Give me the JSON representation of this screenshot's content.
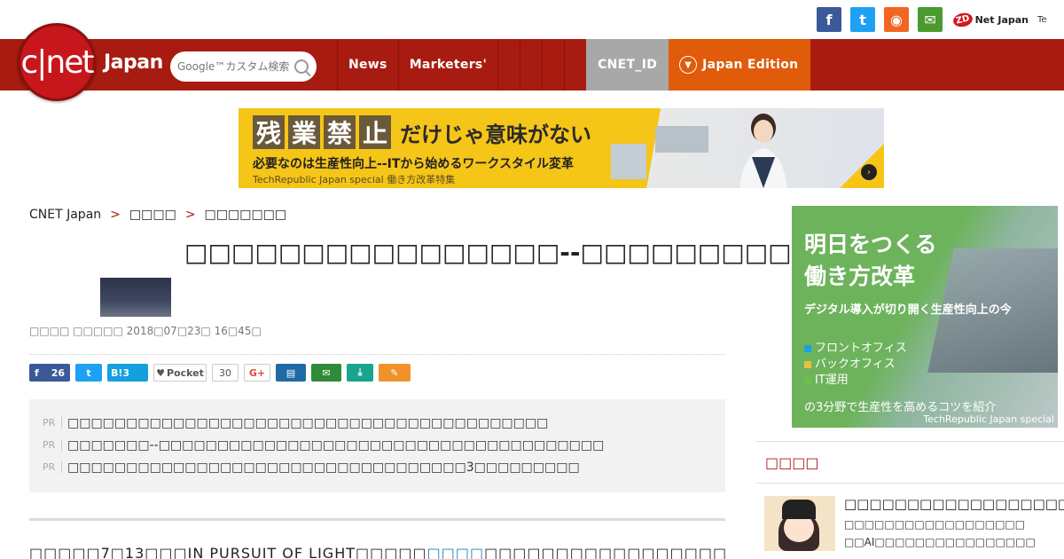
{
  "social": {
    "facebook_glyph": "f",
    "twitter_glyph": "t",
    "rss_glyph": "◉",
    "mail_glyph": "✉",
    "zdnet_badge": "ZD",
    "zdnet_label": "Net Japan",
    "techrepublic_label": "Te"
  },
  "nav": {
    "logo_text": "c|net",
    "logo_japan": "Japan",
    "search_placeholder": "Google™カスタム検索",
    "items": [
      "News",
      "Marketers'"
    ],
    "cnet_id": "CNET_ID",
    "edition": "Japan Edition"
  },
  "banner": {
    "kanji": [
      "残",
      "業",
      "禁",
      "止"
    ],
    "headline_rest": "だけじゃ意味がない",
    "subline": "必要なのは生産性向上--ITから始めるワークスタイル変革",
    "footer": "TechRepublic Japan special 働き方改革特集",
    "arrow": "›"
  },
  "breadcrumb": {
    "home": "CNET Japan",
    "sep1": ">",
    "level1": "□□□□",
    "sep2": ">",
    "level2": "□□□□□□□"
  },
  "article": {
    "headline": "□□□□□□□□□□□□□□□□--□□□□□□□□□□□□□□",
    "byline": "□□□□ □□□□□  2018□07□23□ 16□45□",
    "body_prefix": "□□□□□7□13□□□IN PURSUIT OF LIGHT□□□□□",
    "body_link": "□□□□",
    "body_suffix": "□□□□□□□□□□□□□□□□□□□□□□□□□□□□"
  },
  "share": {
    "fb_count": "26",
    "hatena": "B!3",
    "pocket": "Pocket",
    "pocket_count": "30",
    "gplus": "G+",
    "print_glyph": "▤",
    "mail_glyph": "✉",
    "save_glyph": "⤓",
    "clip_glyph": "✎"
  },
  "pr": {
    "tag": "PR",
    "items": [
      "□□□□□□□□□□□□□□□□□□□□□□□□□□□□□□□□□□□□□□□□□",
      "□□□□□□□--□□□□□□□□□□□□□□□□□□□□□□□□□□□□□□□□□□□□□□",
      "□□□□□□□□□□□□□□□□□□□□□□□□□□□□□□□□□□3□□□□□□□□□"
    ]
  },
  "sidead": {
    "line1": "明日をつくる",
    "line2": "働き方改革",
    "subtitle": "デジタル導入が切り開く生産性向上の今",
    "list": [
      "フロントオフィス",
      "バックオフィス",
      "IT運用"
    ],
    "list_colors": [
      "#1ea0e0",
      "#e8c040",
      "#6cc04a"
    ],
    "footer": "の3分野で生産性を高めるコツを紹介",
    "brand": "TechRepublic Japan special"
  },
  "sidebar": {
    "heading": "□□□□",
    "item": {
      "title": "□□□□□□□□□□□□□□□□□□",
      "line1": "□□□□□□□□□□□□□□□□□□",
      "line2": "□□AI□□□□□□□□□□□□□□□□"
    }
  }
}
